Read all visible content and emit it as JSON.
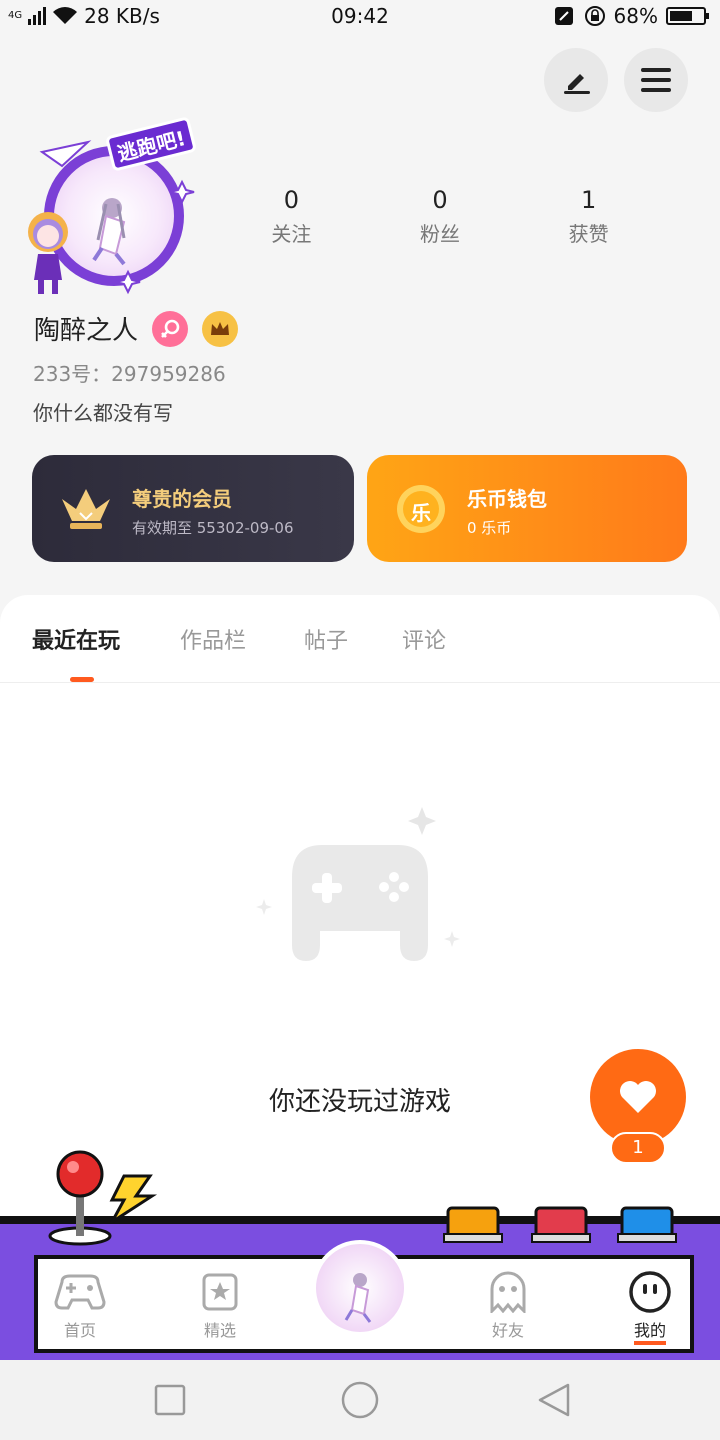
{
  "status_bar": {
    "network_label": "4G",
    "speed": "28 KB/s",
    "time": "09:42",
    "battery": "68%",
    "battery_level": 0.68
  },
  "header": {
    "edit_icon": "pen-icon",
    "menu_icon": "menu-icon"
  },
  "profile": {
    "avatar_badge": "逃跑吧!",
    "name": "陶醉之人",
    "uid": "233号：297959286",
    "bio": "你什么都没有写",
    "stats": [
      {
        "value": "0",
        "label": "关注"
      },
      {
        "value": "0",
        "label": "粉丝"
      },
      {
        "value": "1",
        "label": "获赞"
      }
    ]
  },
  "cards": {
    "vip": {
      "title": "尊贵的会员",
      "subtitle": "有效期至 55302-09-06"
    },
    "coin": {
      "title": "乐币钱包",
      "subtitle": "0 乐币",
      "icon_text": "乐"
    }
  },
  "tabs": [
    "最近在玩",
    "作品栏",
    "帖子",
    "评论"
  ],
  "empty_state": {
    "text": "你还没玩过游戏"
  },
  "like": {
    "count": "1"
  },
  "bottom_nav": [
    {
      "label": "首页",
      "icon": "gamepad-icon"
    },
    {
      "label": "精选",
      "icon": "star-bookmark-icon"
    },
    {
      "label": "好友",
      "icon": "ghost-icon"
    },
    {
      "label": "我的",
      "icon": "smiley-icon"
    }
  ],
  "colors": {
    "accent": "#ff5a1f",
    "vip_gold": "#f4cd7c",
    "arcade_purple": "#7b4ee0"
  }
}
